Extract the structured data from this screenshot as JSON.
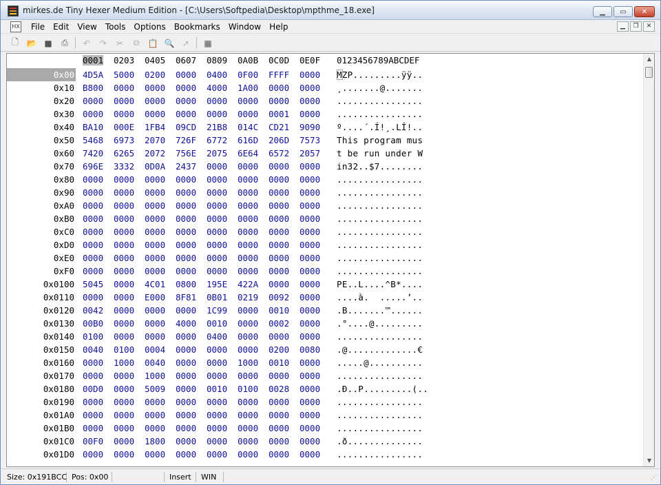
{
  "window": {
    "title": "mirkes.de Tiny Hexer Medium Edition - [C:\\Users\\Softpedia\\Desktop\\mpthme_18.exe]",
    "icon": "hex-app-icon"
  },
  "menu": {
    "items": [
      "File",
      "Edit",
      "View",
      "Tools",
      "Options",
      "Bookmarks",
      "Window",
      "Help"
    ]
  },
  "toolbar": {
    "buttons": [
      "new-file-icon",
      "open-folder-icon",
      "save-icon",
      "print-icon",
      "undo-icon",
      "redo-icon",
      "cut-icon",
      "copy-icon",
      "paste-icon",
      "find-icon",
      "goto-icon",
      "calculator-icon"
    ]
  },
  "hex_view": {
    "column_headers": [
      "0001",
      "0203",
      "0405",
      "0607",
      "0809",
      "0A0B",
      "0C0D",
      "0E0F"
    ],
    "ascii_header": "0123456789ABCDEF",
    "selected_address": "0x00",
    "rows": [
      {
        "addr": "0x00",
        "hex": [
          "4D5A",
          "5000",
          "0200",
          "0000",
          "0400",
          "0F00",
          "FFFF",
          "0000"
        ],
        "ascii": "MZP.........ÿÿ.."
      },
      {
        "addr": "0x10",
        "hex": [
          "B800",
          "0000",
          "0000",
          "0000",
          "4000",
          "1A00",
          "0000",
          "0000"
        ],
        "ascii": "¸.......@......."
      },
      {
        "addr": "0x20",
        "hex": [
          "0000",
          "0000",
          "0000",
          "0000",
          "0000",
          "0000",
          "0000",
          "0000"
        ],
        "ascii": "................"
      },
      {
        "addr": "0x30",
        "hex": [
          "0000",
          "0000",
          "0000",
          "0000",
          "0000",
          "0000",
          "0001",
          "0000"
        ],
        "ascii": "................"
      },
      {
        "addr": "0x40",
        "hex": [
          "BA10",
          "000E",
          "1FB4",
          "09CD",
          "21B8",
          "014C",
          "CD21",
          "9090"
        ],
        "ascii": "º....´.Í!¸.LÍ!.."
      },
      {
        "addr": "0x50",
        "hex": [
          "5468",
          "6973",
          "2070",
          "726F",
          "6772",
          "616D",
          "206D",
          "7573"
        ],
        "ascii": "This program mus"
      },
      {
        "addr": "0x60",
        "hex": [
          "7420",
          "6265",
          "2072",
          "756E",
          "2075",
          "6E64",
          "6572",
          "2057"
        ],
        "ascii": "t be run under W"
      },
      {
        "addr": "0x70",
        "hex": [
          "696E",
          "3332",
          "0D0A",
          "2437",
          "0000",
          "0000",
          "0000",
          "0000"
        ],
        "ascii": "in32..$7........"
      },
      {
        "addr": "0x80",
        "hex": [
          "0000",
          "0000",
          "0000",
          "0000",
          "0000",
          "0000",
          "0000",
          "0000"
        ],
        "ascii": "................"
      },
      {
        "addr": "0x90",
        "hex": [
          "0000",
          "0000",
          "0000",
          "0000",
          "0000",
          "0000",
          "0000",
          "0000"
        ],
        "ascii": "................"
      },
      {
        "addr": "0xA0",
        "hex": [
          "0000",
          "0000",
          "0000",
          "0000",
          "0000",
          "0000",
          "0000",
          "0000"
        ],
        "ascii": "................"
      },
      {
        "addr": "0xB0",
        "hex": [
          "0000",
          "0000",
          "0000",
          "0000",
          "0000",
          "0000",
          "0000",
          "0000"
        ],
        "ascii": "................"
      },
      {
        "addr": "0xC0",
        "hex": [
          "0000",
          "0000",
          "0000",
          "0000",
          "0000",
          "0000",
          "0000",
          "0000"
        ],
        "ascii": "................"
      },
      {
        "addr": "0xD0",
        "hex": [
          "0000",
          "0000",
          "0000",
          "0000",
          "0000",
          "0000",
          "0000",
          "0000"
        ],
        "ascii": "................"
      },
      {
        "addr": "0xE0",
        "hex": [
          "0000",
          "0000",
          "0000",
          "0000",
          "0000",
          "0000",
          "0000",
          "0000"
        ],
        "ascii": "................"
      },
      {
        "addr": "0xF0",
        "hex": [
          "0000",
          "0000",
          "0000",
          "0000",
          "0000",
          "0000",
          "0000",
          "0000"
        ],
        "ascii": "................"
      },
      {
        "addr": "0x0100",
        "hex": [
          "5045",
          "0000",
          "4C01",
          "0800",
          "195E",
          "422A",
          "0000",
          "0000"
        ],
        "ascii": "PE..L....^B*...."
      },
      {
        "addr": "0x0110",
        "hex": [
          "0000",
          "0000",
          "E000",
          "8F81",
          "0B01",
          "0219",
          "0092",
          "0000"
        ],
        "ascii": "....à.  .....’.."
      },
      {
        "addr": "0x0120",
        "hex": [
          "0042",
          "0000",
          "0000",
          "0000",
          "1C99",
          "0000",
          "0010",
          "0000"
        ],
        "ascii": ".B.......™......"
      },
      {
        "addr": "0x0130",
        "hex": [
          "00B0",
          "0000",
          "0000",
          "4000",
          "0010",
          "0000",
          "0002",
          "0000"
        ],
        "ascii": ".°....@........."
      },
      {
        "addr": "0x0140",
        "hex": [
          "0100",
          "0000",
          "0000",
          "0000",
          "0400",
          "0000",
          "0000",
          "0000"
        ],
        "ascii": "................"
      },
      {
        "addr": "0x0150",
        "hex": [
          "0040",
          "0100",
          "0004",
          "0000",
          "0000",
          "0000",
          "0200",
          "0080"
        ],
        "ascii": ".@.............€"
      },
      {
        "addr": "0x0160",
        "hex": [
          "0000",
          "1000",
          "0040",
          "0000",
          "0000",
          "1000",
          "0010",
          "0000"
        ],
        "ascii": ".....@.........."
      },
      {
        "addr": "0x0170",
        "hex": [
          "0000",
          "0000",
          "1000",
          "0000",
          "0000",
          "0000",
          "0000",
          "0000"
        ],
        "ascii": "................"
      },
      {
        "addr": "0x0180",
        "hex": [
          "00D0",
          "0000",
          "5009",
          "0000",
          "0010",
          "0100",
          "0028",
          "0000"
        ],
        "ascii": ".Ð..P.........(.."
      },
      {
        "addr": "0x0190",
        "hex": [
          "0000",
          "0000",
          "0000",
          "0000",
          "0000",
          "0000",
          "0000",
          "0000"
        ],
        "ascii": "................"
      },
      {
        "addr": "0x01A0",
        "hex": [
          "0000",
          "0000",
          "0000",
          "0000",
          "0000",
          "0000",
          "0000",
          "0000"
        ],
        "ascii": "................"
      },
      {
        "addr": "0x01B0",
        "hex": [
          "0000",
          "0000",
          "0000",
          "0000",
          "0000",
          "0000",
          "0000",
          "0000"
        ],
        "ascii": "................"
      },
      {
        "addr": "0x01C0",
        "hex": [
          "00F0",
          "0000",
          "1800",
          "0000",
          "0000",
          "0000",
          "0000",
          "0000"
        ],
        "ascii": ".ð.............."
      },
      {
        "addr": "0x01D0",
        "hex": [
          "0000",
          "0000",
          "0000",
          "0000",
          "0000",
          "0000",
          "0000",
          "0000"
        ],
        "ascii": "................"
      }
    ]
  },
  "status": {
    "size": "Size: 0x191BCC",
    "pos": "Pos: 0x00",
    "empty": "",
    "mode": "Insert",
    "charset": "WIN"
  }
}
